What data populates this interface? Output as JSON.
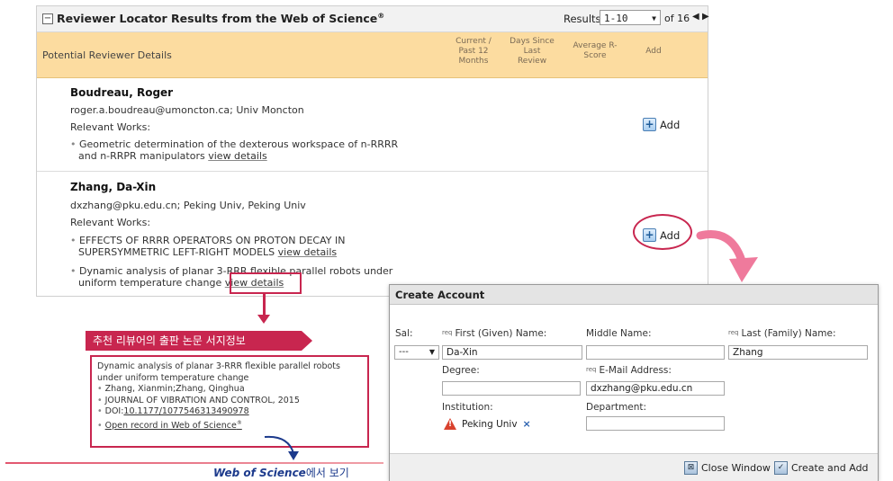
{
  "panel": {
    "title": "Reviewer Locator Results from the Web of Science",
    "title_sup": "®",
    "results_label": "Results",
    "page_range": "1-10",
    "total": "of 16",
    "columns": {
      "details": "Potential Reviewer Details",
      "current_12": "Current /\nPast 12\nMonths",
      "days_since": "Days Since\nLast\nReview",
      "avg_score": "Average R-\nScore",
      "add": "Add"
    }
  },
  "reviewers": [
    {
      "name": "Boudreau, Roger",
      "contact": "roger.a.boudreau@umoncton.ca; Univ Moncton",
      "relevant_label": "Relevant Works:",
      "works": [
        {
          "line1": "Geometric determination of the dexterous workspace of n-RRRR",
          "line2": "and n-RRPR manipulators",
          "link": "view details"
        }
      ],
      "add_label": "Add"
    },
    {
      "name": "Zhang, Da-Xin",
      "contact": "dxzhang@pku.edu.cn; Peking Univ, Peking Univ",
      "relevant_label": "Relevant Works:",
      "works": [
        {
          "line1": "EFFECTS OF RRRR OPERATORS ON PROTON DECAY IN",
          "line2": "SUPERSYMMETRIC LEFT-RIGHT MODELS",
          "link": "view details"
        },
        {
          "line1": "Dynamic analysis of planar 3-RRR flexible parallel robots under",
          "line2": "uniform temperature change",
          "link": "view details"
        }
      ],
      "add_label": "Add"
    }
  ],
  "callout": {
    "banner": "추천 리뷰어의 출판 논문 서지정보",
    "title": "Dynamic analysis of planar 3-RRR flexible parallel robots under uniform temperature change",
    "authors": "Zhang, Xianmin;Zhang, Qinghua",
    "journal": "JOURNAL OF VIBRATION AND CONTROL, 2015",
    "doi_label": "DOI:",
    "doi": "10.1177/1077546313490978",
    "open_record": "Open record in Web of Science",
    "open_record_sup": "®",
    "caption_brand": "Web of Science",
    "caption_rest": "에서 보기"
  },
  "dialog": {
    "title": "Create Account",
    "sal_label": "Sal:",
    "sal_value": "---",
    "req_tag": "req",
    "first_label": "First (Given) Name:",
    "first_value": "Da-Xin",
    "middle_label": "Middle Name:",
    "middle_value": "",
    "last_label": "Last (Family) Name:",
    "last_value": "Zhang",
    "degree_label": "Degree:",
    "degree_value": "",
    "email_label": "E-Mail Address:",
    "email_value": "dxzhang@pku.edu.cn",
    "institution_label": "Institution:",
    "institution_value": "Peking Univ",
    "department_label": "Department:",
    "department_value": "",
    "close_label": "Close Window",
    "create_label": "Create and Add"
  },
  "colors": {
    "accent": "#c8264f",
    "header_bg": "#fcdca0",
    "link_blue": "#1c3a8c"
  }
}
